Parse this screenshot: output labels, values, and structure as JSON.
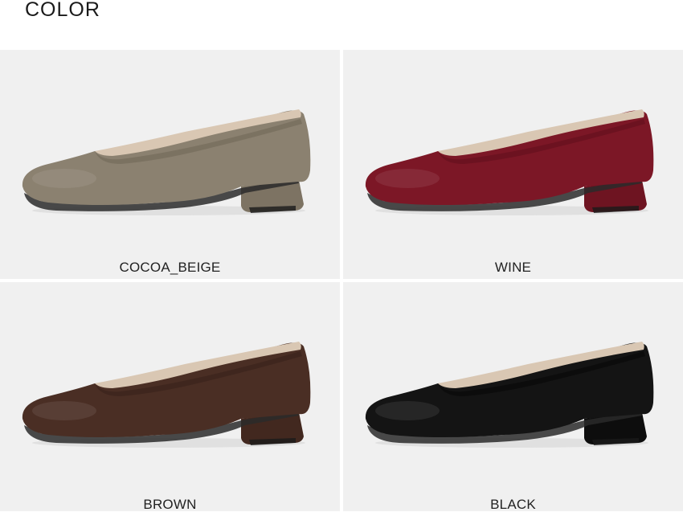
{
  "section": {
    "title": "COLOR"
  },
  "swatches": [
    {
      "label": "COCOA_BEIGE",
      "color": "#8b8170",
      "shade": "#6f6656",
      "heel": "#7d7363"
    },
    {
      "label": "WINE",
      "color": "#7c1726",
      "shade": "#5f0f1b",
      "heel": "#6e1421"
    },
    {
      "label": "BROWN",
      "color": "#4a2e24",
      "shade": "#372019",
      "heel": "#42281f"
    },
    {
      "label": "BLACK",
      "color": "#141414",
      "shade": "#050505",
      "heel": "#0d0d0d"
    }
  ]
}
